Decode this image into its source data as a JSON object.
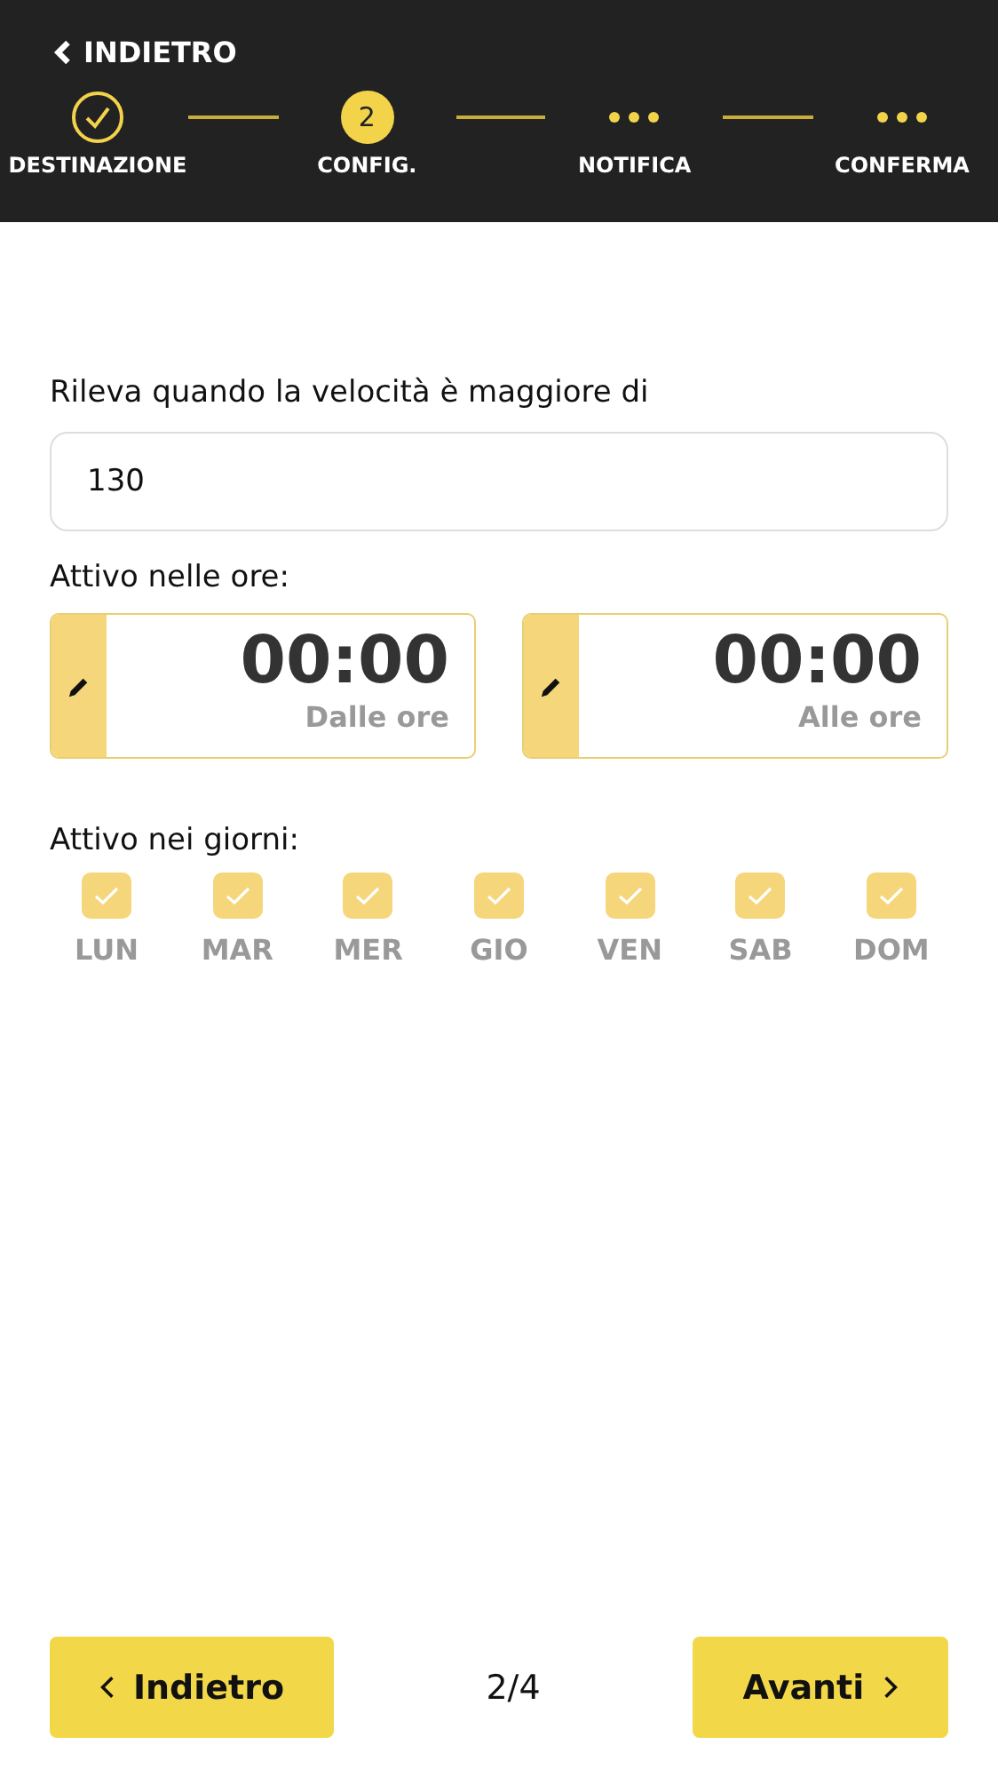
{
  "header": {
    "back_label": "INDIETRO"
  },
  "steps": [
    {
      "label": "DESTINAZIONE",
      "kind": "done"
    },
    {
      "label": "CONFIG.",
      "kind": "current",
      "number": "2"
    },
    {
      "label": "NOTIFICA",
      "kind": "pending"
    },
    {
      "label": "CONFERMA",
      "kind": "pending"
    }
  ],
  "speed": {
    "label": "Rileva quando la velocità è maggiore di",
    "value": "130"
  },
  "hours": {
    "label": "Attivo nelle ore:",
    "fields": [
      {
        "time": "00:00",
        "caption": "Dalle ore"
      },
      {
        "time": "00:00",
        "caption": "Alle ore"
      }
    ]
  },
  "days": {
    "label": "Attivo nei giorni:",
    "items": [
      {
        "label": "LUN",
        "checked": true
      },
      {
        "label": "MAR",
        "checked": true
      },
      {
        "label": "MER",
        "checked": true
      },
      {
        "label": "GIO",
        "checked": true
      },
      {
        "label": "VEN",
        "checked": true
      },
      {
        "label": "SAB",
        "checked": true
      },
      {
        "label": "DOM",
        "checked": true
      }
    ]
  },
  "footer": {
    "back": "Indietro",
    "page": "2/4",
    "next": "Avanti"
  }
}
